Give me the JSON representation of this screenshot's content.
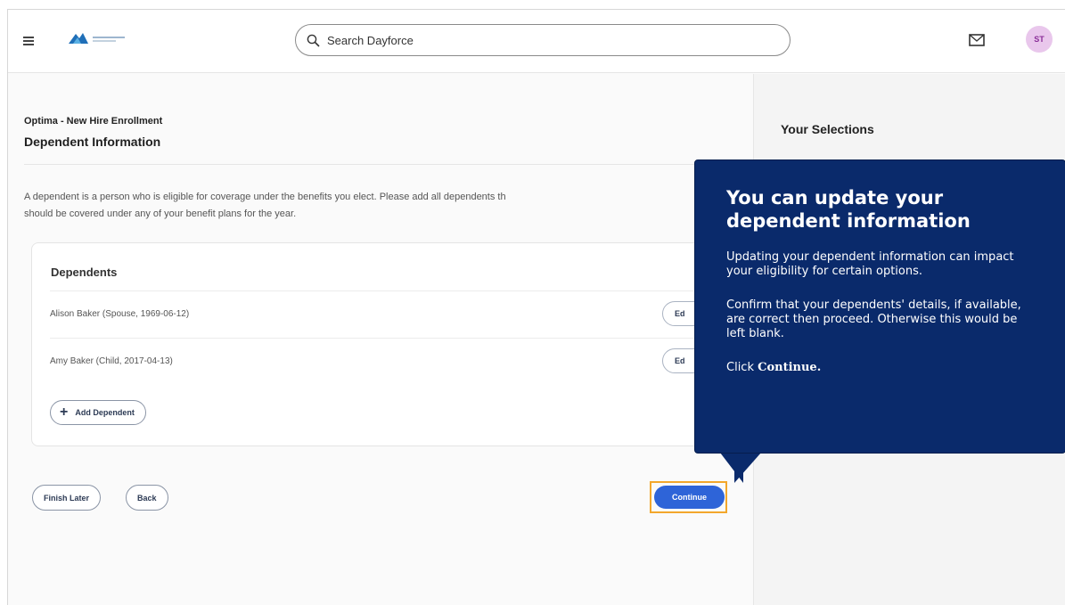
{
  "header": {
    "search_placeholder": "Search Dayforce",
    "avatar_initials": "ST"
  },
  "main": {
    "breadcrumb": "Optima - New Hire Enrollment",
    "title": "Dependent Information",
    "description_line1": "A dependent is a person who is eligible for coverage under the benefits you elect. Please add all dependents th",
    "description_line2": "should be covered under any of your benefit plans for the year.",
    "dependents_title": "Dependents",
    "dependents": [
      {
        "name": "Alison Baker (Spouse, 1969-06-12)",
        "edit_label": "Ed"
      },
      {
        "name": "Amy Baker (Child, 2017-04-13)",
        "edit_label": "Ed"
      }
    ],
    "add_dependent_label": "Add Dependent",
    "finish_later_label": "Finish Later",
    "back_label": "Back",
    "continue_label": "Continue"
  },
  "right_panel": {
    "title": "Your Selections"
  },
  "tooltip": {
    "title": "You can update your dependent information",
    "para1": "Updating your dependent information can impact your eligibility for certain options.",
    "para2": "Confirm that your dependents' details, if available, are correct then proceed. Otherwise this would be left blank.",
    "cta_prefix": "Click ",
    "cta_bold": "Continue."
  },
  "colors": {
    "tooltip_bg": "#0a2a6b",
    "primary_button": "#2e64d8",
    "highlight_outline": "#f3a72c",
    "avatar_bg": "#e9c7ec"
  },
  "icons": [
    "hamburger-menu-icon",
    "company-logo",
    "search-icon",
    "mail-icon",
    "plus-icon"
  ]
}
